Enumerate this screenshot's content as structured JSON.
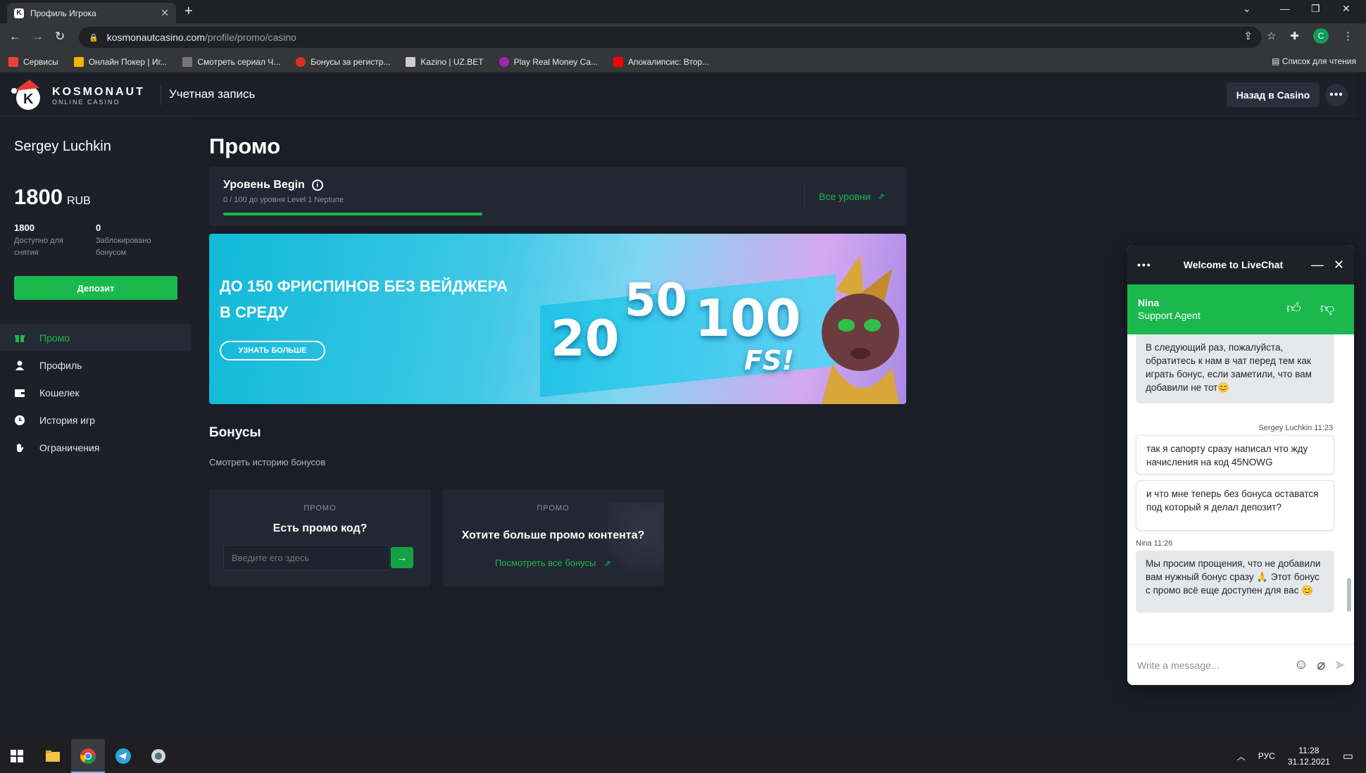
{
  "browser": {
    "tab_title": "Профиль Игрока",
    "url_host": "kosmonautcasino.com",
    "url_path": "/profile/promo/casino",
    "profile_initial": "C",
    "bookmarks": [
      {
        "label": "Сервисы",
        "color": "#e94235"
      },
      {
        "label": "Онлайн Покер | Иг...",
        "color": "#f4b400"
      },
      {
        "label": "Смотреть сериал Ч...",
        "color": "#777777"
      },
      {
        "label": "Бонусы за регистр...",
        "color": "#d93025"
      },
      {
        "label": "Kazino | UZ.BET",
        "color": "#cccccc"
      },
      {
        "label": "Play Real Money Ca...",
        "color": "#9c27b0"
      },
      {
        "label": "Апокалипсис: Втор...",
        "color": "#ff0000"
      }
    ],
    "reading_list": "Список для чтения"
  },
  "header": {
    "logo_title": "KOSMONAUT",
    "logo_sub": "ONLINE CASINO",
    "account_label": "Учетная запись",
    "back_button": "Назад в Casino",
    "more_label": "•••"
  },
  "sidebar": {
    "username": "Sergey Luchkin",
    "balance": "1800",
    "currency": "RUB",
    "available_value": "1800",
    "available_label": "Доступно для снятия",
    "blocked_value": "0",
    "blocked_label": "Заблокировано бонусом",
    "deposit_button": "Депозит",
    "menu": [
      {
        "label": "Промо",
        "icon": "gift-icon"
      },
      {
        "label": "Профиль",
        "icon": "user-icon"
      },
      {
        "label": "Кошелек",
        "icon": "wallet-icon"
      },
      {
        "label": "История игр",
        "icon": "clock-icon"
      },
      {
        "label": "Ограничения",
        "icon": "hand-icon"
      }
    ]
  },
  "main": {
    "page_title": "Промо",
    "level": {
      "name": "Уровень Begin",
      "progress_text": "0 / 100 до уровня Level 1 Neptune",
      "progress_fraction": 0,
      "all_levels_link": "Все уровни"
    },
    "banner": {
      "headline_line1": "ДО 150 ФРИСПИНОВ БЕЗ ВЕЙДЖЕРА",
      "headline_line2": "В СРЕДУ",
      "button": "УЗНАТЬ БОЛЬШЕ",
      "num1": "20",
      "num2": "50",
      "num3": "100",
      "fs": "FS!"
    },
    "bonuses_title": "Бонусы",
    "bonus_history_link": "Смотреть историю бонусов",
    "promo_code_card": {
      "tag": "ПРОМО",
      "title": "Есть промо код?",
      "placeholder": "Введите его здесь"
    },
    "promo_content_card": {
      "tag": "ПРОМО",
      "title": "Хотите больше промо контента?",
      "link": "Посмотреть все бонусы"
    }
  },
  "livechat": {
    "title": "Welcome to LiveChat",
    "agent_name": "Nina",
    "agent_role": "Support Agent",
    "messages": [
      {
        "text": "В следующий раз, пожалуйста, обратитесь к нам в чат перед тем как играть бонус, если заметили, что вам добавили не тот😊"
      },
      {
        "meta": "Sergey Luchkin 11:23"
      },
      {
        "text": "так я сапорту сразу написал что жду начисления на код 45NOWG"
      },
      {
        "text": "и что мне теперь без бонуса оставатся под который я делал депозит?"
      },
      {
        "meta": "Nina 11:26"
      },
      {
        "text": "Мы просим прощения, что не добавили вам нужный бонус сразу 🙏 Этот бонус с промо всё еще доступен для вас 😊"
      }
    ],
    "input_placeholder": "Write a message..."
  },
  "taskbar": {
    "lang": "РУС",
    "time": "11:28",
    "date": "31.12.2021"
  },
  "colors": {
    "accent_green": "#1bb84d",
    "bg_dark": "#1b1e27",
    "panel": "#232733"
  }
}
